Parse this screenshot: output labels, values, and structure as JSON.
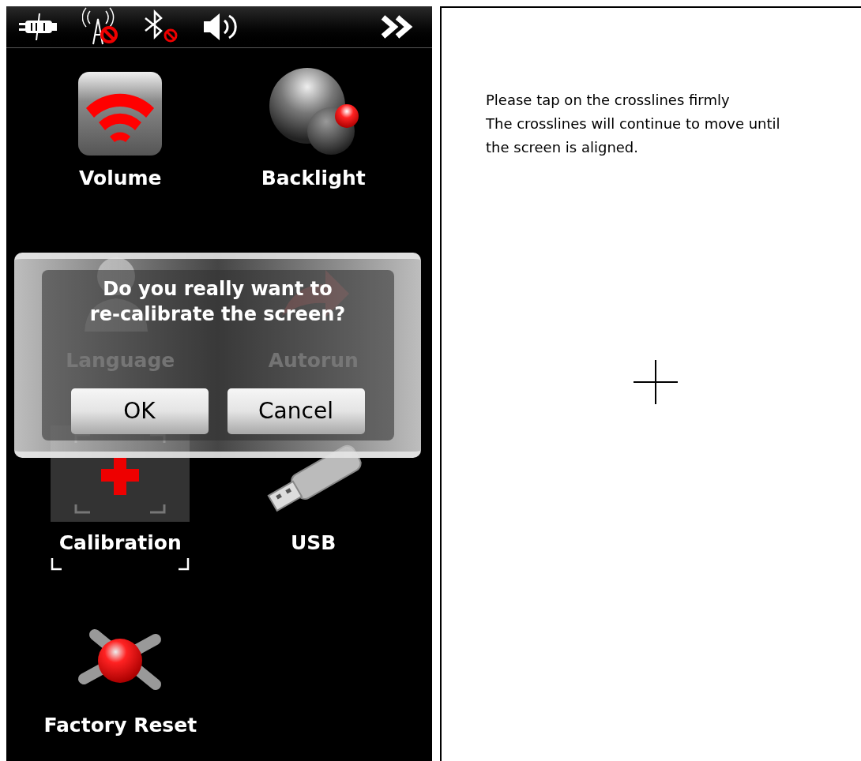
{
  "settings_screen": {
    "items": [
      {
        "kind": "volume",
        "label": "Volume",
        "selected": false
      },
      {
        "kind": "backlight",
        "label": "Backlight",
        "selected": false
      },
      {
        "kind": "language",
        "label": "Language",
        "selected": false
      },
      {
        "kind": "autorun",
        "label": "Autorun",
        "selected": false
      },
      {
        "kind": "calibration",
        "label": "Calibration",
        "selected": true
      },
      {
        "kind": "usb",
        "label": "USB",
        "selected": false
      },
      {
        "kind": "reset",
        "label": "Factory Reset",
        "selected": false
      }
    ],
    "dialog": {
      "message_lines": [
        "Do you really want to",
        "re-calibrate the screen?"
      ],
      "buttons": [
        "OK",
        "Cancel"
      ]
    }
  },
  "calibration_screen": {
    "instruction_lines": [
      "Please tap on the crosslines firmly",
      "The crosslines will continue to move until",
      "the screen is aligned."
    ]
  }
}
